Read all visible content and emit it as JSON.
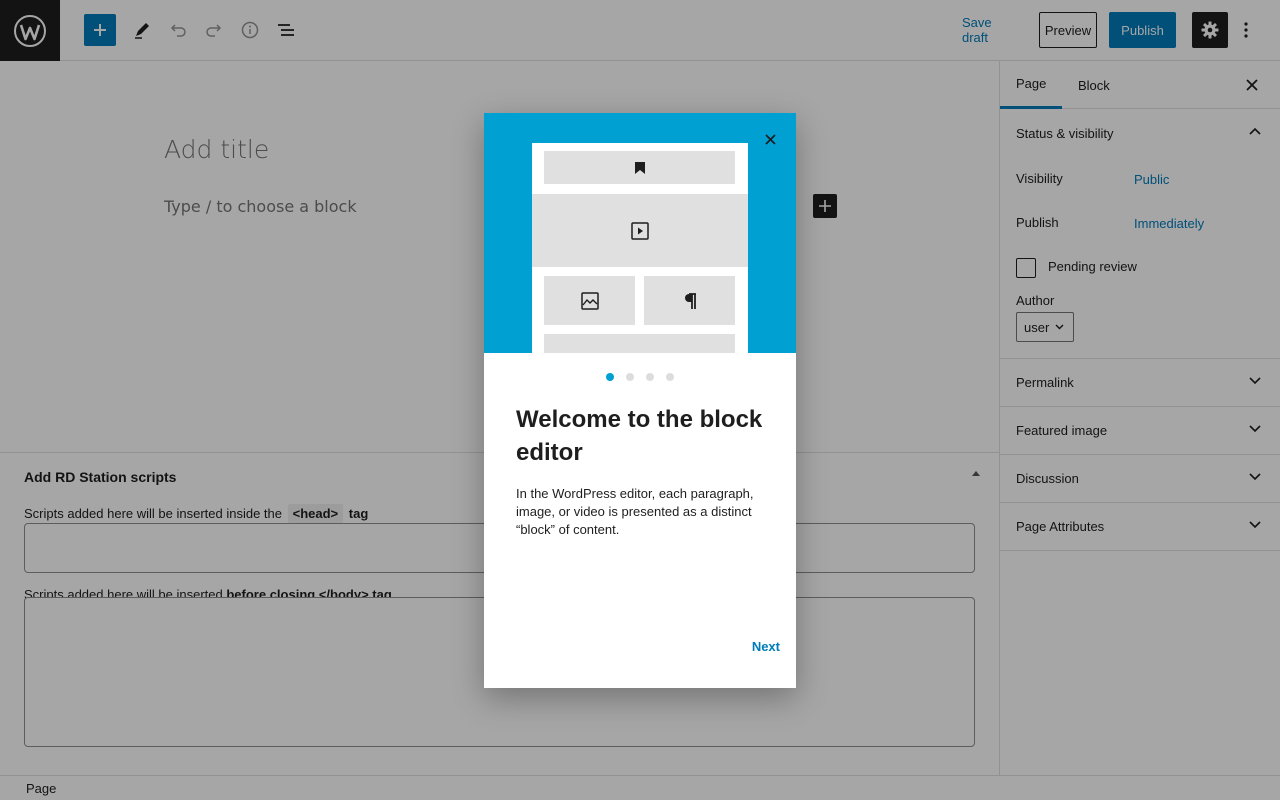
{
  "toolbar": {
    "logo_icon": "wordpress-logo-icon",
    "inserter_icon": "plus-icon",
    "tools_icon": "pencil-icon",
    "undo_icon": "undo-icon",
    "redo_icon": "redo-icon",
    "details_icon": "info-icon",
    "list_view_icon": "list-view-icon",
    "save_draft_label": "Save draft",
    "preview_label": "Preview",
    "publish_label": "Publish",
    "settings_icon": "gear-icon",
    "more_icon": "vertical-ellipsis-icon"
  },
  "editor": {
    "title_placeholder": "Add title",
    "block_placeholder": "Type / to choose a block"
  },
  "metabox": {
    "title": "Add RD Station scripts",
    "head_label_before": "Scripts added here will be inserted inside the",
    "head_tag": "<head>",
    "head_label_after": "tag",
    "body_label_before": "Scripts added here will be inserted",
    "body_label_bold": "before closing </body> tag",
    "head_value": "",
    "body_value": ""
  },
  "footer": {
    "breadcrumb": "Page"
  },
  "sidebar": {
    "tabs": [
      {
        "label": "Page",
        "active": true
      },
      {
        "label": "Block",
        "active": false
      }
    ],
    "status": {
      "title": "Status & visibility",
      "visibility_label": "Visibility",
      "visibility_value": "Public",
      "publish_label": "Publish",
      "publish_value": "Immediately",
      "pending_label": "Pending review",
      "pending_checked": false,
      "author_label": "Author",
      "author_value": "user"
    },
    "panels": [
      {
        "title": "Permalink"
      },
      {
        "title": "Featured image"
      },
      {
        "title": "Discussion"
      },
      {
        "title": "Page Attributes"
      }
    ]
  },
  "guide": {
    "heading": "Welcome to the block editor",
    "body": "In the WordPress editor, each paragraph, image, or video is presented as a distinct “block” of content.",
    "next_label": "Next",
    "page_count": 4,
    "current_page": 1,
    "hero_color": "#00a0d2"
  },
  "colors": {
    "accent": "#007cba",
    "dark": "#1e1e1e"
  }
}
